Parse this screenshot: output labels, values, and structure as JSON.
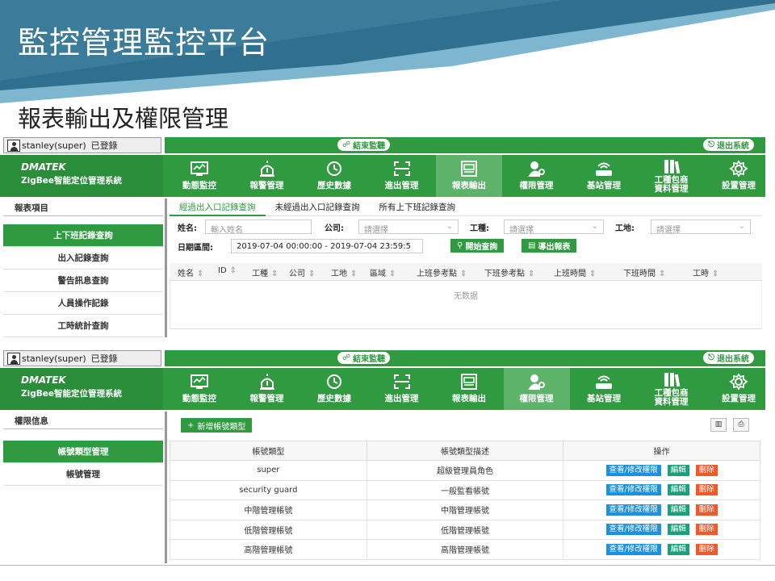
{
  "slide": {
    "title": "監控管理監控平台",
    "subtitle": "報表輸出及權限管理",
    "colors": {
      "banner_dark": "#2f6f8f",
      "banner_light": "#7fb6cf",
      "app_green": "#2f9a3f"
    }
  },
  "app": {
    "user": "stanley(super)",
    "login_status": "已登錄",
    "end_monitor": "結束監聽",
    "logout": "退出系統",
    "brand_line1": "DMATEK",
    "brand_line2": "ZigBee智能定位管理系統",
    "nav": [
      {
        "label": "動態監控",
        "icon": "monitor-icon"
      },
      {
        "label": "報警管理",
        "icon": "alarm-icon"
      },
      {
        "label": "歷史數據",
        "icon": "history-icon"
      },
      {
        "label": "進出管理",
        "icon": "scan-icon"
      },
      {
        "label": "報表輸出",
        "icon": "report-icon"
      },
      {
        "label": "權限管理",
        "icon": "user-key-icon"
      },
      {
        "label": "基站管理",
        "icon": "router-icon"
      },
      {
        "label": "工種包商",
        "label2": "資料管理",
        "icon": "books-icon"
      },
      {
        "label": "設置管理",
        "icon": "gear-icon"
      }
    ]
  },
  "report": {
    "sidebar_header": "報表項目",
    "sidebar_items": [
      "上下班記錄查詢",
      "出入記錄查詢",
      "警告訊息查詢",
      "人員操作記錄",
      "工時統計查詢"
    ],
    "active_sidebar": 0,
    "tabs": [
      "經過出入口記錄查詢",
      "未經過出入口記錄查詢",
      "所有上下班記錄查詢"
    ],
    "active_tab": 0,
    "filters": {
      "name_label": "姓名:",
      "name_placeholder": "輸入姓名",
      "company_label": "公司:",
      "company_placeholder": "請選擇",
      "worktype_label": "工種:",
      "worktype_placeholder": "請選擇",
      "site_label": "工地:",
      "site_placeholder": "請選擇",
      "date_label": "日期區間:",
      "date_value": "2019-07-04 00:00:00 - 2019-07-04 23:59:5",
      "search_button": "開始查詢",
      "export_button": "導出報表"
    },
    "columns": [
      "姓名",
      "ID",
      "工種",
      "公司",
      "工地",
      "區域",
      "上班參考點",
      "下班參考點",
      "上班時間",
      "下班時間",
      "工時"
    ],
    "empty_text": "无数据"
  },
  "permission": {
    "sidebar_header": "權限信息",
    "sidebar_items": [
      "帳號類型管理",
      "帳號管理"
    ],
    "active_sidebar": 0,
    "add_button": "新增帳號類型",
    "columns": [
      "帳號類型",
      "帳號類型描述",
      "操作"
    ],
    "rows": [
      {
        "type": "super",
        "desc": "超級管理員角色"
      },
      {
        "type": "security guard",
        "desc": "一般監看帳號"
      },
      {
        "type": "中階管理帳號",
        "desc": "中階管理帳號"
      },
      {
        "type": "低階管理帳號",
        "desc": "低階管理帳號"
      },
      {
        "type": "高階管理帳號",
        "desc": "高階管理帳號"
      }
    ],
    "actions": {
      "view": "查看/修改權限",
      "edit": "編輯",
      "delete": "刪除"
    }
  }
}
